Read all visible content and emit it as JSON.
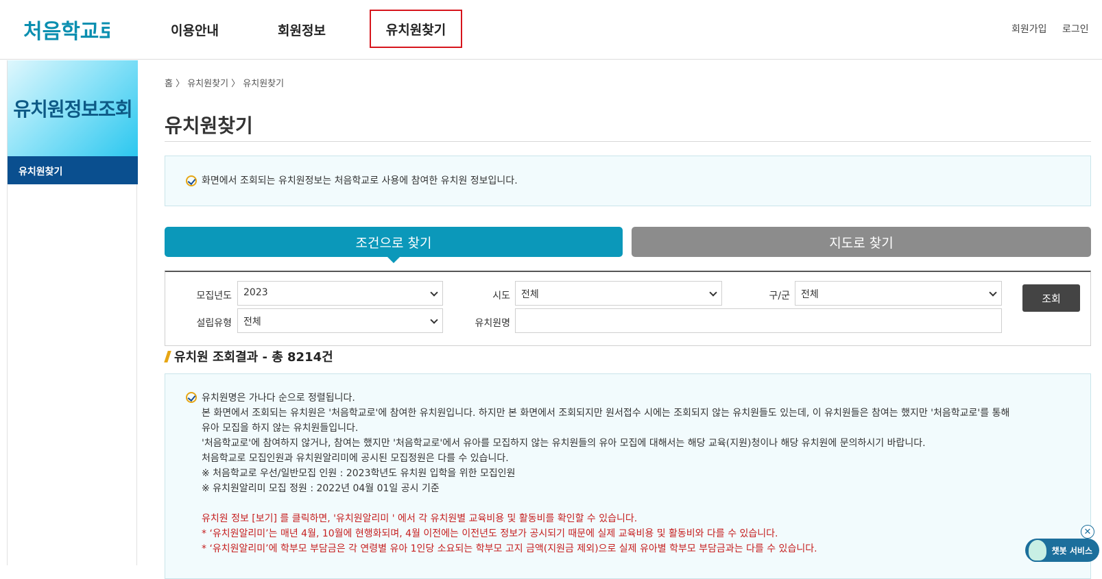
{
  "header": {
    "logo_text": "처음학교로",
    "nav": [
      "이용안내",
      "회원정보",
      "유치원찾기"
    ],
    "util": {
      "join": "회원가입",
      "login": "로그인"
    }
  },
  "sidebar": {
    "title": "유치원정보조회",
    "items": [
      {
        "label": "유치원찾기"
      }
    ]
  },
  "breadcrumb": "홈 〉 유치원찾기 〉 유치원찾기",
  "page_title": "유치원찾기",
  "notice": "화면에서 조회되는 유치원정보는 처음학교로 사용에 참여한 유치원 정보입니다.",
  "tabs": {
    "condition": "조건으로 찾기",
    "map": "지도로 찾기"
  },
  "search": {
    "year_label": "모집년도",
    "year_value": "2023",
    "sido_label": "시도",
    "sido_value": "전체",
    "gugun_label": "구/군",
    "gugun_value": "전체",
    "type_label": "설립유형",
    "type_value": "전체",
    "name_label": "유치원명",
    "name_value": "",
    "submit": "조회"
  },
  "result_title": "유치원 조회결과 - 총 8214건",
  "info_lines": [
    "유치원명은 가나다 순으로 정렬됩니다.",
    "본 화면에서 조회되는 유치원은 '처음학교로'에 참여한 유치원입니다. 하지만 본 화면에서 조회되지만 원서접수 시에는 조회되지 않는 유치원들도 있는데, 이 유치원들은 참여는 했지만 '처음학교로'를 통해",
    "유아 모집을 하지 않는 유치원들입니다.",
    "'처음학교로'에 참여하지 않거나, 참여는 했지만 '처음학교로'에서 유아를 모집하지 않는 유치원들의 유아 모집에 대해서는 해당 교육(지원)청이나 해당 유치원에 문의하시기 바랍니다.",
    "처음학교로 모집인원과 유치원알리미에 공시된 모집정원은 다를 수 있습니다.",
    " ※ 처음학교로 우선/일반모집 인원 : 2023학년도 유치원 입학을 위한 모집인원",
    " ※ 유치원알리미 모집 정원 : 2022년 04월 01일 공시 기준"
  ],
  "red_lines": [
    "유치원 정보 [보기] 를 클릭하면, '유치원알리미 ' 에서 각 유치원별 교육비용 및 활동비를 확인할 수 있습니다.",
    "* ‘유치원알리미’는 매년 4월, 10월에 현행화되며, 4월 이전에는 이전년도 정보가 공시되기 때문에 실제 교육비용 및 활동비와 다를 수 있습니다.",
    "* ‘유치원알리미’에 학부모 부담금은 각 연령별 유아 1인당 소요되는 학부모 고지 금액(지원금 제외)으로 실제 유아별 학부모 부담금과는 다를 수 있습니다."
  ],
  "chatbot": {
    "label": "챗봇 서비스",
    "close": "✕"
  },
  "colors": {
    "accent": "#0b98ba",
    "sidebar_active": "#0a4f8f",
    "highlight": "#d6141b",
    "warning_text": "#c51e1e"
  }
}
